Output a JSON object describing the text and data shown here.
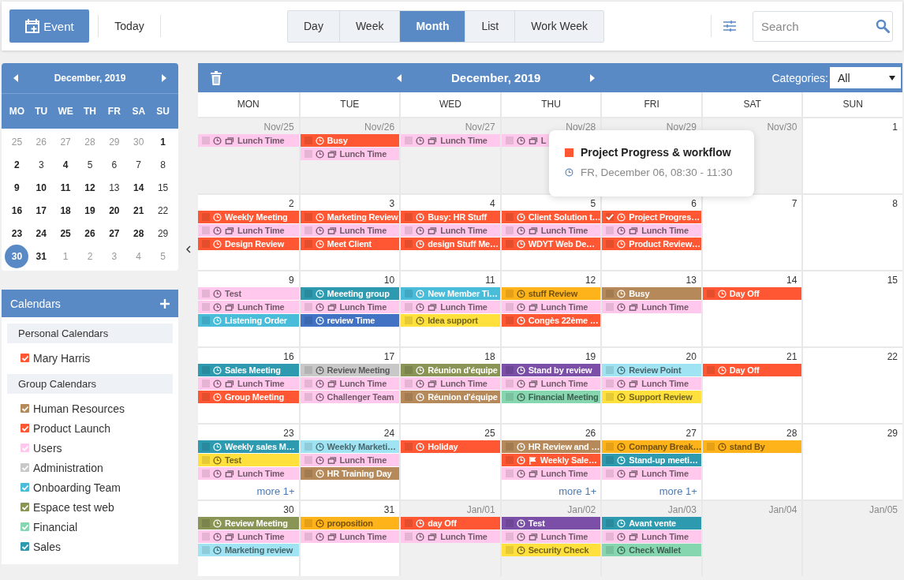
{
  "toolbar": {
    "new_button": "Event",
    "today_button": "Today",
    "views": [
      {
        "label": "Day",
        "selected": false
      },
      {
        "label": "Week",
        "selected": false
      },
      {
        "label": "Month",
        "selected": true
      },
      {
        "label": "List",
        "selected": false
      },
      {
        "label": "Work Week",
        "selected": false
      }
    ],
    "search": {
      "placeholder": "Search"
    }
  },
  "mini_calendar": {
    "title": "December, 2019",
    "weekdays": [
      "MO",
      "TU",
      "WE",
      "TH",
      "FR",
      "SA",
      "SU"
    ],
    "weeks": [
      [
        {
          "day": "25",
          "muted": true,
          "bold": false,
          "selected": false
        },
        {
          "day": "26",
          "muted": true,
          "bold": false,
          "selected": false
        },
        {
          "day": "27",
          "muted": true,
          "bold": false,
          "selected": false
        },
        {
          "day": "28",
          "muted": true,
          "bold": false,
          "selected": false
        },
        {
          "day": "29",
          "muted": true,
          "bold": false,
          "selected": false
        },
        {
          "day": "30",
          "muted": true,
          "bold": false,
          "selected": false
        },
        {
          "day": "1",
          "muted": false,
          "bold": true,
          "selected": false
        }
      ],
      [
        {
          "day": "2",
          "muted": false,
          "bold": true,
          "selected": false
        },
        {
          "day": "3",
          "muted": false,
          "bold": false,
          "selected": false
        },
        {
          "day": "4",
          "muted": false,
          "bold": true,
          "selected": false
        },
        {
          "day": "5",
          "muted": false,
          "bold": false,
          "selected": false
        },
        {
          "day": "6",
          "muted": false,
          "bold": false,
          "selected": false
        },
        {
          "day": "7",
          "muted": false,
          "bold": false,
          "selected": false
        },
        {
          "day": "8",
          "muted": false,
          "bold": false,
          "selected": false
        }
      ],
      [
        {
          "day": "9",
          "muted": false,
          "bold": true,
          "selected": false
        },
        {
          "day": "10",
          "muted": false,
          "bold": true,
          "selected": false
        },
        {
          "day": "11",
          "muted": false,
          "bold": true,
          "selected": false
        },
        {
          "day": "12",
          "muted": false,
          "bold": true,
          "selected": false
        },
        {
          "day": "13",
          "muted": false,
          "bold": false,
          "selected": false
        },
        {
          "day": "14",
          "muted": false,
          "bold": true,
          "selected": false
        },
        {
          "day": "15",
          "muted": false,
          "bold": false,
          "selected": false
        }
      ],
      [
        {
          "day": "16",
          "muted": false,
          "bold": true,
          "selected": false
        },
        {
          "day": "17",
          "muted": false,
          "bold": true,
          "selected": false
        },
        {
          "day": "18",
          "muted": false,
          "bold": true,
          "selected": false
        },
        {
          "day": "19",
          "muted": false,
          "bold": true,
          "selected": false
        },
        {
          "day": "20",
          "muted": false,
          "bold": true,
          "selected": false
        },
        {
          "day": "21",
          "muted": false,
          "bold": true,
          "selected": false
        },
        {
          "day": "22",
          "muted": false,
          "bold": false,
          "selected": false
        }
      ],
      [
        {
          "day": "23",
          "muted": false,
          "bold": true,
          "selected": false
        },
        {
          "day": "24",
          "muted": false,
          "bold": true,
          "selected": false
        },
        {
          "day": "25",
          "muted": false,
          "bold": true,
          "selected": false
        },
        {
          "day": "26",
          "muted": false,
          "bold": true,
          "selected": false
        },
        {
          "day": "27",
          "muted": false,
          "bold": true,
          "selected": false
        },
        {
          "day": "28",
          "muted": false,
          "bold": true,
          "selected": false
        },
        {
          "day": "29",
          "muted": false,
          "bold": false,
          "selected": false
        }
      ],
      [
        {
          "day": "30",
          "muted": false,
          "bold": true,
          "selected": true
        },
        {
          "day": "31",
          "muted": false,
          "bold": true,
          "selected": false
        },
        {
          "day": "1",
          "muted": true,
          "bold": false,
          "selected": false
        },
        {
          "day": "2",
          "muted": true,
          "bold": false,
          "selected": false
        },
        {
          "day": "3",
          "muted": true,
          "bold": false,
          "selected": false
        },
        {
          "day": "4",
          "muted": true,
          "bold": false,
          "selected": false
        },
        {
          "day": "5",
          "muted": true,
          "bold": false,
          "selected": false
        }
      ]
    ]
  },
  "calendars": {
    "title": "Calendars",
    "groups": [
      {
        "title": "Personal Calendars",
        "items": [
          {
            "name": "Mary Harris",
            "color": "#ff5733",
            "checked": true
          }
        ]
      },
      {
        "title": "Group Calendars",
        "items": [
          {
            "name": "Human Resources",
            "color": "#b5895a",
            "checked": true
          },
          {
            "name": "Product Launch",
            "color": "#ff5733",
            "checked": true
          },
          {
            "name": "Users",
            "color": "#ffc8ec",
            "checked": true
          },
          {
            "name": "Administration",
            "color": "#c8c8c8",
            "checked": true
          },
          {
            "name": "Onboarding Team",
            "color": "#48bcd8",
            "checked": true
          },
          {
            "name": "Espace test web",
            "color": "#8a9455",
            "checked": true
          },
          {
            "name": "Financial",
            "color": "#86d6b0",
            "checked": true
          },
          {
            "name": "Sales",
            "color": "#2e9ab0",
            "checked": true
          }
        ]
      }
    ]
  },
  "month": {
    "title": "December, 2019",
    "categories_label": "Categories:",
    "categories_value": "All",
    "weekdays": [
      "MON",
      "TUE",
      "WED",
      "THU",
      "FRI",
      "SAT",
      "SUN"
    ],
    "weeks": [
      [
        {
          "date": "Nov/25",
          "muted": true,
          "events": [
            {
              "title": "Lunch Time",
              "color": "#ffc8ec",
              "kind": "note",
              "checked": false
            }
          ]
        },
        {
          "date": "Nov/26",
          "muted": true,
          "events": [
            {
              "title": "Busy",
              "color": "#ff5733",
              "kind": "plain",
              "checked": false
            },
            {
              "title": "Lunch Time",
              "color": "#ffc8ec",
              "kind": "note",
              "checked": false
            }
          ]
        },
        {
          "date": "Nov/27",
          "muted": true,
          "events": [
            {
              "title": "Lunch Time",
              "color": "#ffc8ec",
              "kind": "note",
              "checked": false
            }
          ]
        },
        {
          "date": "Nov/28",
          "muted": true,
          "events": [
            {
              "title": "L",
              "color": "#ffc8ec",
              "kind": "note",
              "checked": false
            }
          ]
        },
        {
          "date": "Nov/29",
          "muted": true
        },
        {
          "date": "Nov/30",
          "muted": true
        },
        {
          "date": "1",
          "muted": false
        }
      ],
      [
        {
          "date": "2",
          "muted": false,
          "events": [
            {
              "title": "Weekly Meeting",
              "color": "#ff5733",
              "kind": "plain",
              "checked": false
            },
            {
              "title": "Lunch Time",
              "color": "#ffc8ec",
              "kind": "note",
              "checked": false
            },
            {
              "title": "Design Review",
              "color": "#ff5733",
              "kind": "plain",
              "checked": false
            }
          ]
        },
        {
          "date": "3",
          "muted": false,
          "events": [
            {
              "title": "Marketing Review",
              "color": "#ff5733",
              "kind": "plain",
              "checked": false
            },
            {
              "title": "Lunch Time",
              "color": "#ffc8ec",
              "kind": "note",
              "checked": false
            },
            {
              "title": "Meet Client",
              "color": "#ff5733",
              "kind": "plain",
              "checked": false
            }
          ]
        },
        {
          "date": "4",
          "muted": false,
          "events": [
            {
              "title": "Busy: HR Stuff",
              "color": "#ff5733",
              "kind": "plain",
              "checked": false
            },
            {
              "title": "Lunch Time",
              "color": "#ffc8ec",
              "kind": "note",
              "checked": false
            },
            {
              "title": "design Stuff Me…",
              "color": "#ff5733",
              "kind": "plain",
              "checked": false
            }
          ]
        },
        {
          "date": "5",
          "muted": false,
          "events": [
            {
              "title": "Client Solution t…",
              "color": "#ff5733",
              "kind": "plain",
              "checked": false
            },
            {
              "title": "Lunch Time",
              "color": "#ffc8ec",
              "kind": "note",
              "checked": false
            },
            {
              "title": "WDYT Web De…",
              "color": "#ff5733",
              "kind": "plain",
              "checked": false
            }
          ]
        },
        {
          "date": "6",
          "muted": false,
          "events": [
            {
              "title": "Project Progres…",
              "color": "#ff5733",
              "kind": "plain",
              "checked": true
            },
            {
              "title": "Lunch Time",
              "color": "#ffc8ec",
              "kind": "note",
              "checked": false
            },
            {
              "title": "Product Review…",
              "color": "#ff5733",
              "kind": "plain",
              "checked": false
            }
          ]
        },
        {
          "date": "7",
          "muted": false
        },
        {
          "date": "8",
          "muted": false
        }
      ],
      [
        {
          "date": "9",
          "muted": false,
          "events": [
            {
              "title": "Test",
              "color": "#ffc8ec",
              "kind": "plain",
              "checked": false
            },
            {
              "title": "Lunch Time",
              "color": "#ffc8ec",
              "kind": "note",
              "checked": false
            },
            {
              "title": "Listening Order",
              "color": "#48bcd8",
              "kind": "plain",
              "checked": false
            }
          ]
        },
        {
          "date": "10",
          "muted": false,
          "events": [
            {
              "title": "Meeeting group",
              "color": "#2e9ab0",
              "kind": "plain",
              "checked": false
            },
            {
              "title": "Lunch Time",
              "color": "#ffc8ec",
              "kind": "note",
              "checked": false
            },
            {
              "title": "review Time",
              "color": "#4272c4",
              "kind": "plain",
              "checked": false
            }
          ]
        },
        {
          "date": "11",
          "muted": false,
          "events": [
            {
              "title": "New Member Ti…",
              "color": "#48bcd8",
              "kind": "plain",
              "checked": false
            },
            {
              "title": "Lunch Time",
              "color": "#ffc8ec",
              "kind": "note",
              "checked": false
            },
            {
              "title": "Idea support",
              "color": "#ffe03c",
              "kind": "plain",
              "checked": false
            }
          ]
        },
        {
          "date": "12",
          "muted": false,
          "events": [
            {
              "title": "stuff Review",
              "color": "#ffb31a",
              "kind": "plain",
              "checked": false
            },
            {
              "title": "Lunch Time",
              "color": "#ffc8ec",
              "kind": "note",
              "checked": false
            },
            {
              "title": "Congès 22ème …",
              "color": "#ff5733",
              "kind": "plain",
              "checked": false
            }
          ]
        },
        {
          "date": "13",
          "muted": false,
          "events": [
            {
              "title": "Busy",
              "color": "#b5895a",
              "kind": "plain",
              "checked": false
            },
            {
              "title": "Lunch Time",
              "color": "#ffc8ec",
              "kind": "note",
              "checked": false
            }
          ]
        },
        {
          "date": "14",
          "muted": false,
          "events": [
            {
              "title": "Day Off",
              "color": "#ff5733",
              "kind": "plain",
              "checked": false
            }
          ]
        },
        {
          "date": "15",
          "muted": false
        }
      ],
      [
        {
          "date": "16",
          "muted": false,
          "events": [
            {
              "title": "Sales Meeting",
              "color": "#2e9ab0",
              "kind": "plain",
              "checked": false
            },
            {
              "title": "Lunch Time",
              "color": "#ffc8ec",
              "kind": "note",
              "checked": false
            },
            {
              "title": "Group Meeting",
              "color": "#ff5733",
              "kind": "plain",
              "checked": false
            }
          ]
        },
        {
          "date": "17",
          "muted": false,
          "events": [
            {
              "title": "Review Meeting",
              "color": "#c8c8c8",
              "kind": "plain",
              "checked": false
            },
            {
              "title": "Lunch Time",
              "color": "#ffc8ec",
              "kind": "note",
              "checked": false
            },
            {
              "title": "Challenger Team",
              "color": "#ffc8ec",
              "kind": "plain",
              "checked": false
            }
          ]
        },
        {
          "date": "18",
          "muted": false,
          "events": [
            {
              "title": "Réunion d'équipe",
              "color": "#8a9455",
              "kind": "plain",
              "checked": false
            },
            {
              "title": "Lunch Time",
              "color": "#ffc8ec",
              "kind": "note",
              "checked": false
            },
            {
              "title": "Réunion d'équipe",
              "color": "#b5895a",
              "kind": "plain",
              "checked": false
            }
          ]
        },
        {
          "date": "19",
          "muted": false,
          "events": [
            {
              "title": "Stand by review",
              "color": "#7b4fa8",
              "kind": "plain",
              "checked": false
            },
            {
              "title": "Lunch Time",
              "color": "#ffc8ec",
              "kind": "note",
              "checked": false
            },
            {
              "title": "Financial Meeting",
              "color": "#86d6b0",
              "kind": "plain",
              "checked": false
            }
          ]
        },
        {
          "date": "20",
          "muted": false,
          "events": [
            {
              "title": "Review Point",
              "color": "#a0e3f2",
              "kind": "plain",
              "checked": false
            },
            {
              "title": "Lunch Time",
              "color": "#ffc8ec",
              "kind": "note",
              "checked": false
            },
            {
              "title": "Support Review",
              "color": "#ffe03c",
              "kind": "plain",
              "checked": false
            }
          ]
        },
        {
          "date": "21",
          "muted": false,
          "events": [
            {
              "title": "Day Off",
              "color": "#ff5733",
              "kind": "plain",
              "checked": false
            }
          ]
        },
        {
          "date": "22",
          "muted": false
        }
      ],
      [
        {
          "date": "23",
          "muted": false,
          "more": "more 1+",
          "events": [
            {
              "title": "Weekly sales M…",
              "color": "#2e9ab0",
              "kind": "plain",
              "checked": false
            },
            {
              "title": "Test",
              "color": "#ffe03c",
              "kind": "plain",
              "checked": false
            },
            {
              "title": "Lunch Time",
              "color": "#ffc8ec",
              "kind": "note",
              "checked": false
            }
          ]
        },
        {
          "date": "24",
          "muted": false,
          "events": [
            {
              "title": "Weekly Marketi…",
              "color": "#a0e3f2",
              "kind": "plain",
              "checked": false
            },
            {
              "title": "Lunch Time",
              "color": "#ffc8ec",
              "kind": "note",
              "checked": false
            },
            {
              "title": "HR Training Day",
              "color": "#b5895a",
              "kind": "plain",
              "checked": false
            }
          ]
        },
        {
          "date": "25",
          "muted": false,
          "events": [
            {
              "title": "Holiday",
              "color": "#ff5733",
              "kind": "plain",
              "checked": false
            }
          ]
        },
        {
          "date": "26",
          "muted": false,
          "more": "more 1+",
          "events": [
            {
              "title": "HR Review and …",
              "color": "#b5895a",
              "kind": "plain",
              "checked": false
            },
            {
              "title": "Weekly Sale…",
              "color": "#ff5733",
              "kind": "flag",
              "checked": false
            },
            {
              "title": "Lunch Time",
              "color": "#ffc8ec",
              "kind": "note",
              "checked": false
            }
          ]
        },
        {
          "date": "27",
          "muted": false,
          "more": "more 1+",
          "events": [
            {
              "title": "Company Break…",
              "color": "#ffb31a",
              "kind": "plain",
              "checked": false
            },
            {
              "title": "Stand-up meeti…",
              "color": "#2e9ab0",
              "kind": "plain",
              "checked": false
            },
            {
              "title": "Lunch Time",
              "color": "#ffc8ec",
              "kind": "note",
              "checked": false
            }
          ]
        },
        {
          "date": "28",
          "muted": false,
          "events": [
            {
              "title": "stand By",
              "color": "#ffb31a",
              "kind": "plain",
              "checked": false
            }
          ]
        },
        {
          "date": "29",
          "muted": false
        }
      ],
      [
        {
          "date": "30",
          "muted": false,
          "events": [
            {
              "title": "Review Meeting",
              "color": "#8a9455",
              "kind": "plain",
              "checked": false
            },
            {
              "title": "Lunch Time",
              "color": "#ffc8ec",
              "kind": "note",
              "checked": false
            },
            {
              "title": "Marketing review",
              "color": "#a0e3f2",
              "kind": "plain",
              "checked": false
            }
          ]
        },
        {
          "date": "31",
          "muted": false,
          "events": [
            {
              "title": "proposition",
              "color": "#ffb31a",
              "kind": "plain",
              "checked": false
            },
            {
              "title": "Lunch Time",
              "color": "#ffc8ec",
              "kind": "note",
              "checked": false
            }
          ]
        },
        {
          "date": "Jan/01",
          "muted": true,
          "events": [
            {
              "title": "day Off",
              "color": "#ff5733",
              "kind": "plain",
              "checked": false
            },
            {
              "title": "Lunch Time",
              "color": "#ffc8ec",
              "kind": "note",
              "checked": false
            }
          ]
        },
        {
          "date": "Jan/02",
          "muted": true,
          "events": [
            {
              "title": "Test",
              "color": "#7b4fa8",
              "kind": "plain",
              "checked": false
            },
            {
              "title": "Lunch Time",
              "color": "#ffc8ec",
              "kind": "note",
              "checked": false
            },
            {
              "title": "Security Check",
              "color": "#ffe03c",
              "kind": "plain",
              "checked": false
            }
          ]
        },
        {
          "date": "Jan/03",
          "muted": true,
          "events": [
            {
              "title": "Avant vente",
              "color": "#2e9ab0",
              "kind": "plain",
              "checked": false
            },
            {
              "title": "Lunch Time",
              "color": "#ffc8ec",
              "kind": "note",
              "checked": false
            },
            {
              "title": "Check Wallet",
              "color": "#86d6b0",
              "kind": "plain",
              "checked": false
            }
          ]
        },
        {
          "date": "Jan/04",
          "muted": true
        },
        {
          "date": "Jan/05",
          "muted": true
        }
      ]
    ]
  },
  "popover": {
    "title": "Project Progress & workflow",
    "color": "#ff5733",
    "time": "FR, December 06, 08:30 - 11:30"
  }
}
